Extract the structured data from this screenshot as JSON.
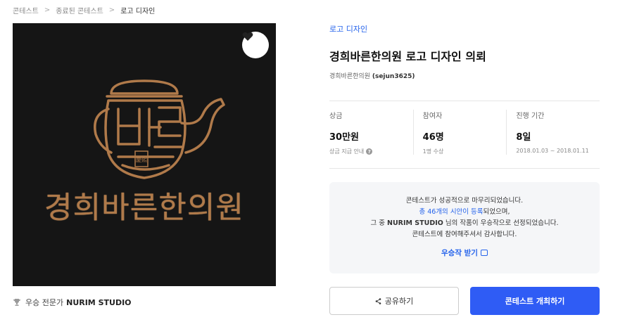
{
  "breadcrumb": {
    "items": [
      "콘테스트",
      "종료된 콘테스트",
      "로고 디자인"
    ],
    "separator": ">"
  },
  "hero": {
    "logo_text": "경희바른한의원",
    "seal_text": "慶熙",
    "favorite_icon": "heart-icon",
    "background": "#151515",
    "gold": "#b07a4a"
  },
  "winner": {
    "prefix": "우승 전문가",
    "name": "NURIM STUDIO",
    "icon": "trophy-icon"
  },
  "contest": {
    "category": "로고 디자인",
    "title": "경희바른한의원 로고 디자인 의뢰",
    "owner_name": "경희바른한의원",
    "owner_id": "(sejun3625)"
  },
  "stats": [
    {
      "label": "상금",
      "value": "30만원",
      "sub": "상금 지급 안내"
    },
    {
      "label": "참여자",
      "value": "46명",
      "sub": "1명 수상"
    },
    {
      "label": "진행 기간",
      "value": "8일",
      "sub": "2018.01.03 ~ 2018.01.11"
    }
  ],
  "notice": {
    "line1": "콘테스트가 성공적으로 마무리되었습니다.",
    "line2_link": "총 46개의 시안이 등록",
    "line2_rest": "되었으며,",
    "line3_pre": "그 중 ",
    "line3_name": "NURIM STUDIO",
    "line3_post": " 님의 작품이 우승작으로 선정되었습니다.",
    "line4": "콘테스트에 참여해주셔서 감사합니다.",
    "get_label": "우승작 받기"
  },
  "actions": {
    "share_label": "공유하기",
    "host_label": "콘테스트 개최하기",
    "accent": "#2f5cf5"
  }
}
